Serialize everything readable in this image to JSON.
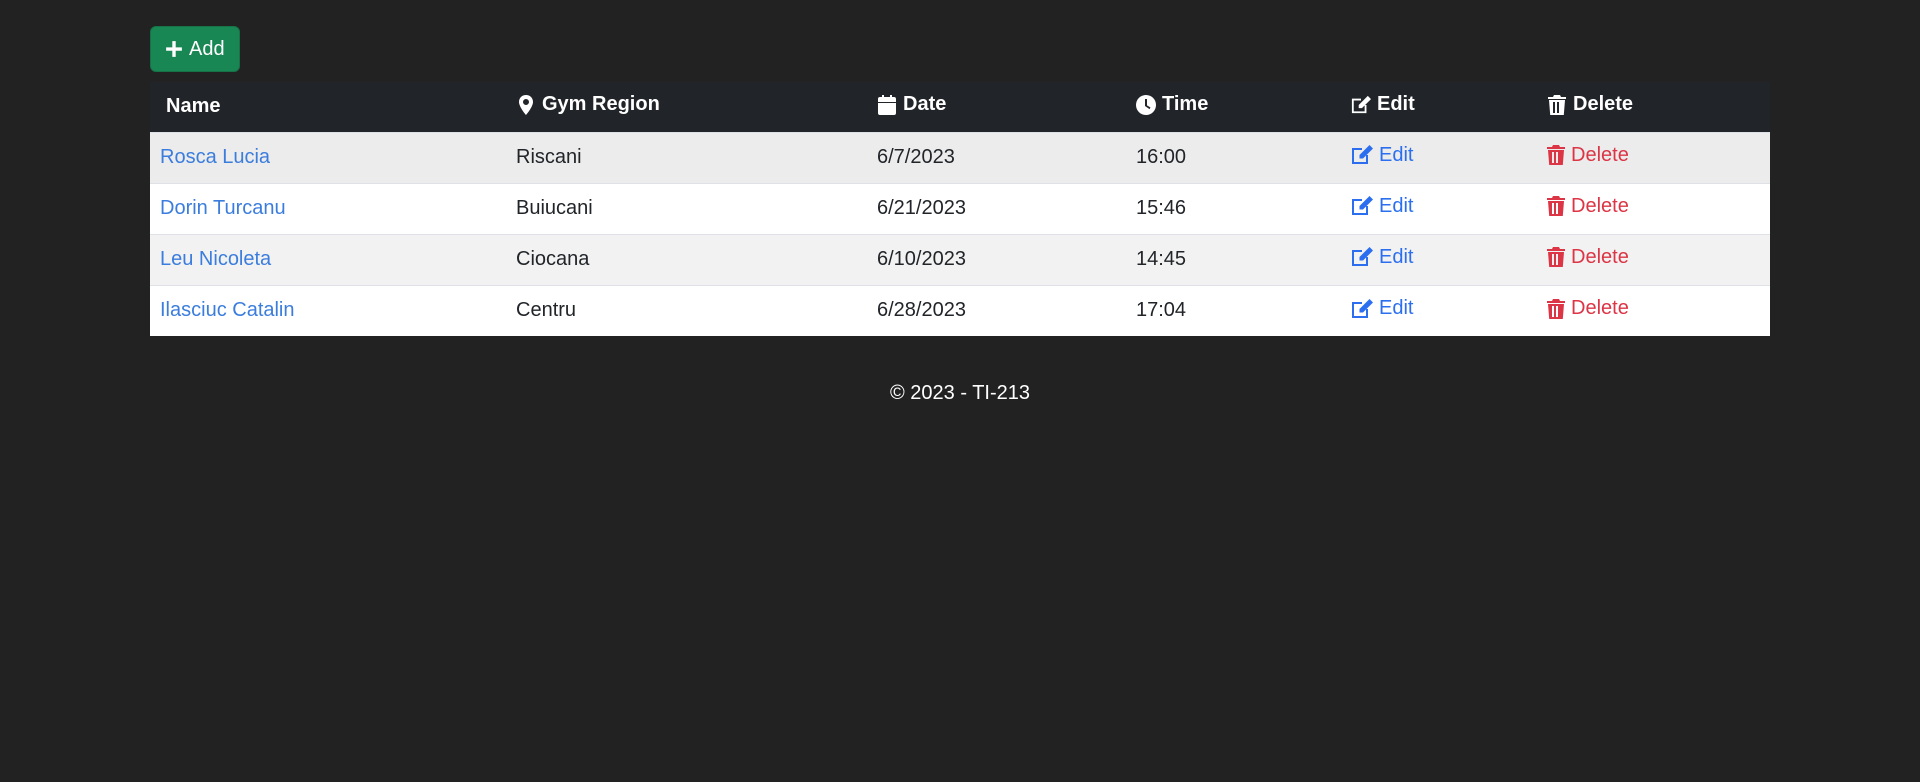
{
  "toolbar": {
    "add_label": "Add"
  },
  "table": {
    "headers": {
      "name": "Name",
      "region": "Gym Region",
      "date": "Date",
      "time": "Time",
      "edit": "Edit",
      "delete": "Delete"
    },
    "rows": [
      {
        "name": "Rosca Lucia",
        "region": "Riscani",
        "date": "6/7/2023",
        "time": "16:00",
        "edit": "Edit",
        "delete": "Delete"
      },
      {
        "name": "Dorin Turcanu",
        "region": "Buiucani",
        "date": "6/21/2023",
        "time": "15:46",
        "edit": "Edit",
        "delete": "Delete"
      },
      {
        "name": "Leu Nicoleta",
        "region": "Ciocana",
        "date": "6/10/2023",
        "time": "14:45",
        "edit": "Edit",
        "delete": "Delete"
      },
      {
        "name": "Ilasciuc Catalin",
        "region": "Centru",
        "date": "6/28/2023",
        "time": "17:04",
        "edit": "Edit",
        "delete": "Delete"
      }
    ]
  },
  "footer": {
    "text": "© 2023 - TI-213"
  },
  "colors": {
    "background": "#222222",
    "add_button": "#198754",
    "table_header": "#212529",
    "link": "#3b7ddd",
    "edit": "#2b6ff0",
    "delete": "#dc3545"
  },
  "icons": {
    "add": "plus-icon",
    "region": "map-marker-icon",
    "date": "calendar-icon",
    "time": "clock-icon",
    "edit": "edit-icon",
    "delete": "trash-icon"
  }
}
